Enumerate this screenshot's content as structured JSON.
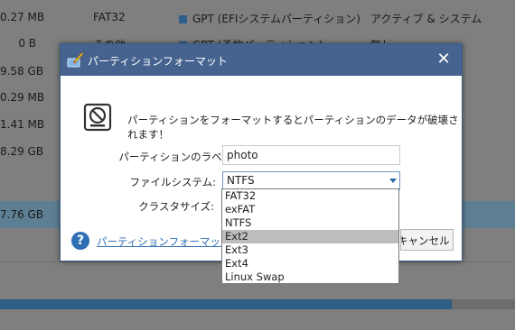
{
  "background_table": {
    "rows": [
      {
        "size": "0.27 MB",
        "fs": "FAT32",
        "type": "GPT (EFIシステムパーティション)",
        "status": "アクティブ & システム"
      },
      {
        "size": "0 B",
        "fs": "その他",
        "type": "GPT (予約パーティション)",
        "status": "無し"
      },
      {
        "size": "9.58 GB",
        "fs": "",
        "type": "",
        "status": ""
      },
      {
        "size": "0.29 MB",
        "fs": "",
        "type": "",
        "status": ""
      },
      {
        "size": "1.41 MB",
        "fs": "",
        "type": "",
        "status": ""
      },
      {
        "size": "8.29 GB",
        "fs": "",
        "type": "",
        "status": ""
      },
      {
        "size": "",
        "fs": "",
        "type": "",
        "status": ""
      },
      {
        "size": "7.76 GB",
        "fs": "",
        "type": "",
        "status": ""
      }
    ]
  },
  "dialog": {
    "title": "パーティションフォーマット",
    "close_symbol": "✕",
    "warning": "パーティションをフォーマットするとパーティションのデータが破壊されます！",
    "partition_label_caption": "パーティションのラベル:",
    "partition_label_value": "photo",
    "file_system_caption": "ファイルシステム:",
    "file_system_value": "NTFS",
    "cluster_size_caption": "クラスタサイズ:",
    "help_icon": "?",
    "help_link": "パーティションフォーマットのチュートリアル",
    "cancel_label": "キャンセル"
  },
  "dropdown": {
    "options": [
      "FAT32",
      "exFAT",
      "NTFS",
      "Ext2",
      "Ext3",
      "Ext4",
      "Linux Swap"
    ],
    "highlighted": "Ext2"
  }
}
